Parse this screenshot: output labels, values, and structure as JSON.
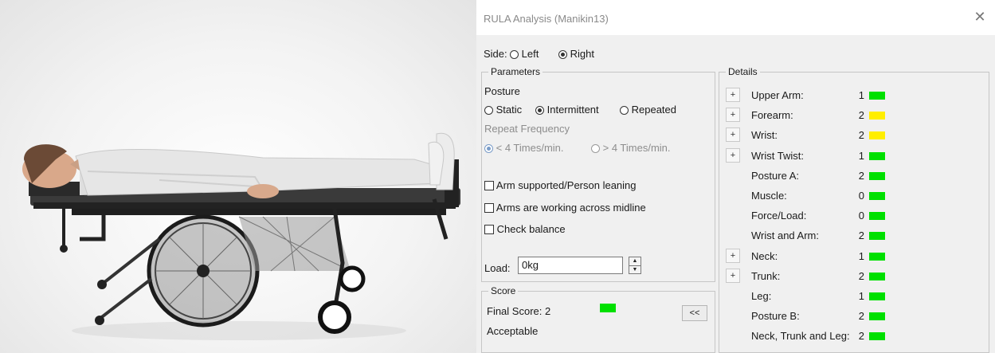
{
  "dialog": {
    "title": "RULA Analysis (Manikin13)",
    "close_icon": "close-icon",
    "side": {
      "label": "Side:",
      "options": [
        "Left",
        "Right"
      ],
      "selected": "Right"
    },
    "parameters": {
      "legend": "Parameters",
      "posture_label": "Posture",
      "posture_options": [
        "Static",
        "Intermittent",
        "Repeated"
      ],
      "posture_selected": "Intermittent",
      "repeat_frequency_label": "Repeat Frequency",
      "repeat_options": [
        "< 4 Times/min.",
        "> 4 Times/min."
      ],
      "repeat_selected": "< 4 Times/min.",
      "checkboxes": [
        {
          "label": "Arm supported/Person leaning",
          "checked": false
        },
        {
          "label": "Arms are working across midline",
          "checked": false
        },
        {
          "label": "Check balance",
          "checked": false
        }
      ],
      "load_label": "Load:",
      "load_value": "0kg"
    },
    "score": {
      "legend": "Score",
      "final_score_label": "Final Score: 2",
      "final_score_color": "#00e000",
      "verdict": "Acceptable",
      "collapse_button": "<<"
    },
    "details": {
      "legend": "Details",
      "expand_label": "+",
      "rows": [
        {
          "label": "Upper Arm:",
          "value": "1",
          "color": "green",
          "expandable": true
        },
        {
          "label": "Forearm:",
          "value": "2",
          "color": "yellow",
          "expandable": true
        },
        {
          "label": "Wrist:",
          "value": "2",
          "color": "yellow",
          "expandable": true
        },
        {
          "label": "Wrist Twist:",
          "value": "1",
          "color": "green",
          "expandable": true
        },
        {
          "label": "Posture A:",
          "value": "2",
          "color": "green",
          "expandable": false
        },
        {
          "label": "Muscle:",
          "value": "0",
          "color": "green",
          "expandable": false
        },
        {
          "label": "Force/Load:",
          "value": "0",
          "color": "green",
          "expandable": false
        },
        {
          "label": "Wrist and Arm:",
          "value": "2",
          "color": "green",
          "expandable": false
        },
        {
          "label": "Neck:",
          "value": "1",
          "color": "green",
          "expandable": true
        },
        {
          "label": "Trunk:",
          "value": "2",
          "color": "green",
          "expandable": true
        },
        {
          "label": "Leg:",
          "value": "1",
          "color": "green",
          "expandable": false
        },
        {
          "label": "Posture B:",
          "value": "2",
          "color": "green",
          "expandable": false
        },
        {
          "label": "Neck, Trunk and Leg:",
          "value": "2",
          "color": "green",
          "expandable": false
        }
      ]
    }
  },
  "colors": {
    "green": "#00e000",
    "yellow": "#ffee00",
    "dialog_bg": "#f0f0f0"
  }
}
